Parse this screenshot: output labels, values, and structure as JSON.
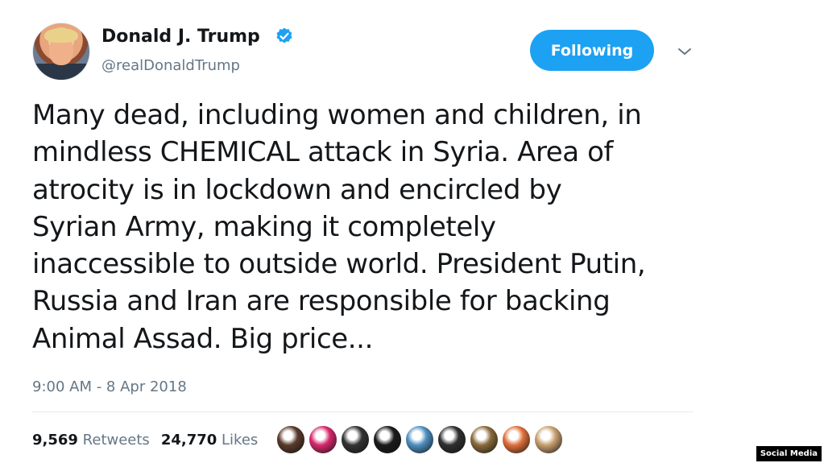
{
  "tweet": {
    "author_name": "Donald J. Trump",
    "author_handle": "@realDonaldTrump",
    "follow_button_label": "Following",
    "text_lines": [
      "Many dead, including women and children, in",
      "mindless CHEMICAL attack in Syria. Area of",
      "atrocity is in lockdown and encircled by",
      "Syrian Army, making it completely",
      "inaccessible to outside world. President Putin,",
      "Russia and Iran are responsible for backing",
      "Animal Assad. Big price..."
    ],
    "timestamp": "9:00 AM - 8 Apr 2018",
    "retweets_count": "9,569",
    "retweets_label": "Retweets",
    "likes_count": "24,770",
    "likes_label": "Likes",
    "liker_avatar_colors": [
      "#5a3a2a",
      "#d6286d",
      "#333333",
      "#1a1a1a",
      "#4f8fc0",
      "#2f2f2f",
      "#8a6a3a",
      "#e0703a",
      "#c8a070"
    ]
  },
  "source_badge": "Social Media",
  "colors": {
    "accent": "#1da1f2",
    "text_primary": "#14171a",
    "text_secondary": "#657786",
    "divider": "#e6ecf0"
  },
  "icons": {
    "verified": "verified-badge-icon",
    "chevron": "chevron-down-icon"
  }
}
